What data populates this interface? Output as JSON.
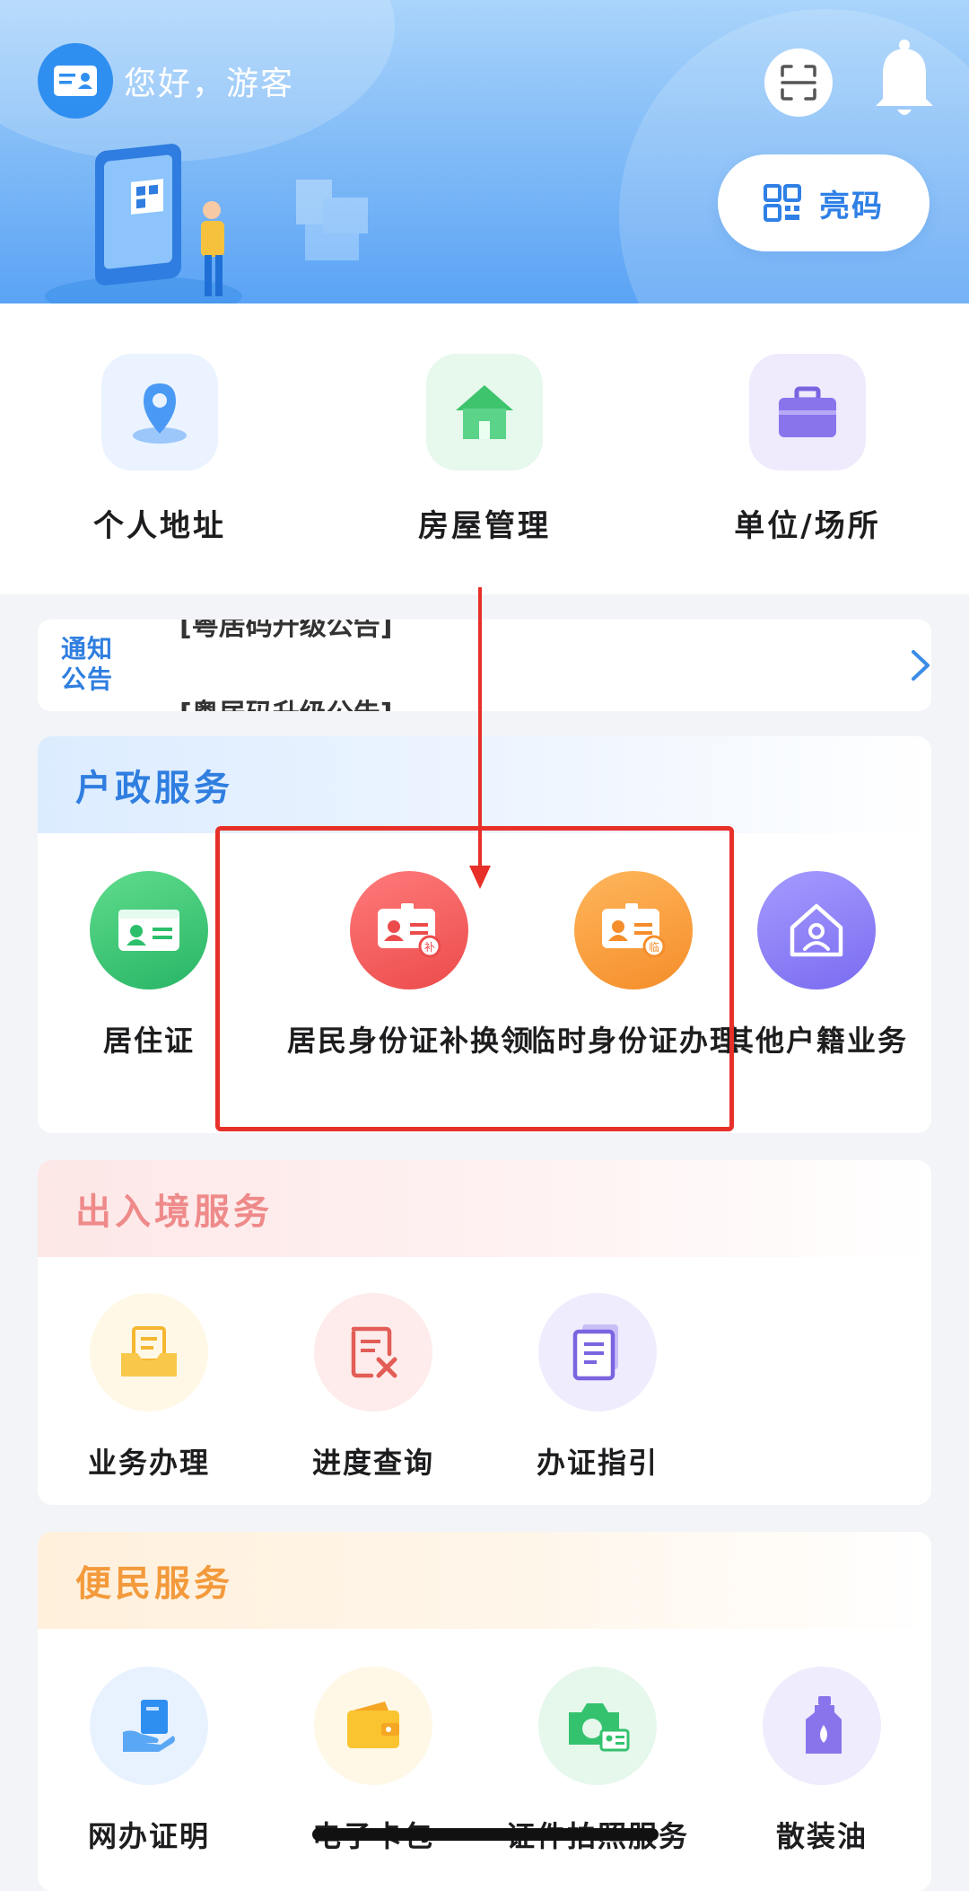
{
  "header": {
    "greeting": "您好，游客",
    "qr_button_label": "亮码",
    "icons": [
      "id-card-icon",
      "scan-icon",
      "bell-icon",
      "qr-code-icon"
    ]
  },
  "quick_actions": [
    {
      "label": "个人地址",
      "icon": "location-pin-icon"
    },
    {
      "label": "房屋管理",
      "icon": "house-icon"
    },
    {
      "label": "单位/场所",
      "icon": "briefcase-icon"
    }
  ],
  "notice": {
    "tag_line1": "通知",
    "tag_line2": "公告",
    "lines": [
      "[粤居码升级公告]",
      "[粤居码升级公告]"
    ]
  },
  "sections": {
    "household": {
      "title": "户政服务",
      "items": [
        {
          "label": "居住证",
          "icon": "residence-card-icon"
        },
        {
          "label": "居民身份证补换领",
          "icon": "id-card-replace-icon"
        },
        {
          "label": "临时身份证办理",
          "icon": "temporary-id-icon"
        },
        {
          "label": "其他户籍业务",
          "icon": "household-house-icon"
        }
      ]
    },
    "entry_exit": {
      "title": "出入境服务",
      "items": [
        {
          "label": "业务办理",
          "icon": "inbox-document-icon"
        },
        {
          "label": "进度查询",
          "icon": "document-cross-icon"
        },
        {
          "label": "办证指引",
          "icon": "guide-document-icon"
        }
      ]
    },
    "convenience": {
      "title": "便民服务",
      "items": [
        {
          "label": "网办证明",
          "icon": "hand-document-icon"
        },
        {
          "label": "电子卡包",
          "icon": "wallet-icon"
        },
        {
          "label": "证件拍照服务",
          "icon": "camera-id-icon"
        },
        {
          "label": "散装油",
          "icon": "oil-bottle-icon"
        }
      ]
    }
  },
  "colors": {
    "primary_blue": "#2f8ff0",
    "highlight_red": "#e8302a",
    "entry_exit_title": "#ef8a8a",
    "convenience_title": "#f39a3c"
  }
}
